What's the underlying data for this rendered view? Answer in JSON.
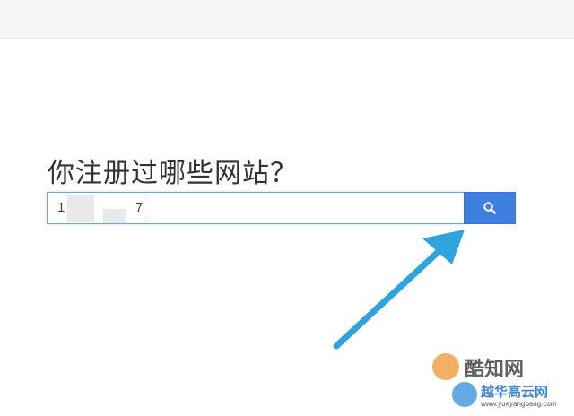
{
  "page": {
    "question": "你注册过哪些网站？"
  },
  "search": {
    "value_start": "1",
    "value_end": "7",
    "button_icon": "search-icon",
    "button_color": "#3f7fe0",
    "border_color": "#66a8e8"
  },
  "annotation": {
    "arrow_color": "#2ea3dc",
    "arrow_icon": "arrow-pointer-icon"
  },
  "watermark": {
    "brand1": "酷知网",
    "brand2": "越华高云网",
    "url": "www.yueyangbang.com"
  }
}
